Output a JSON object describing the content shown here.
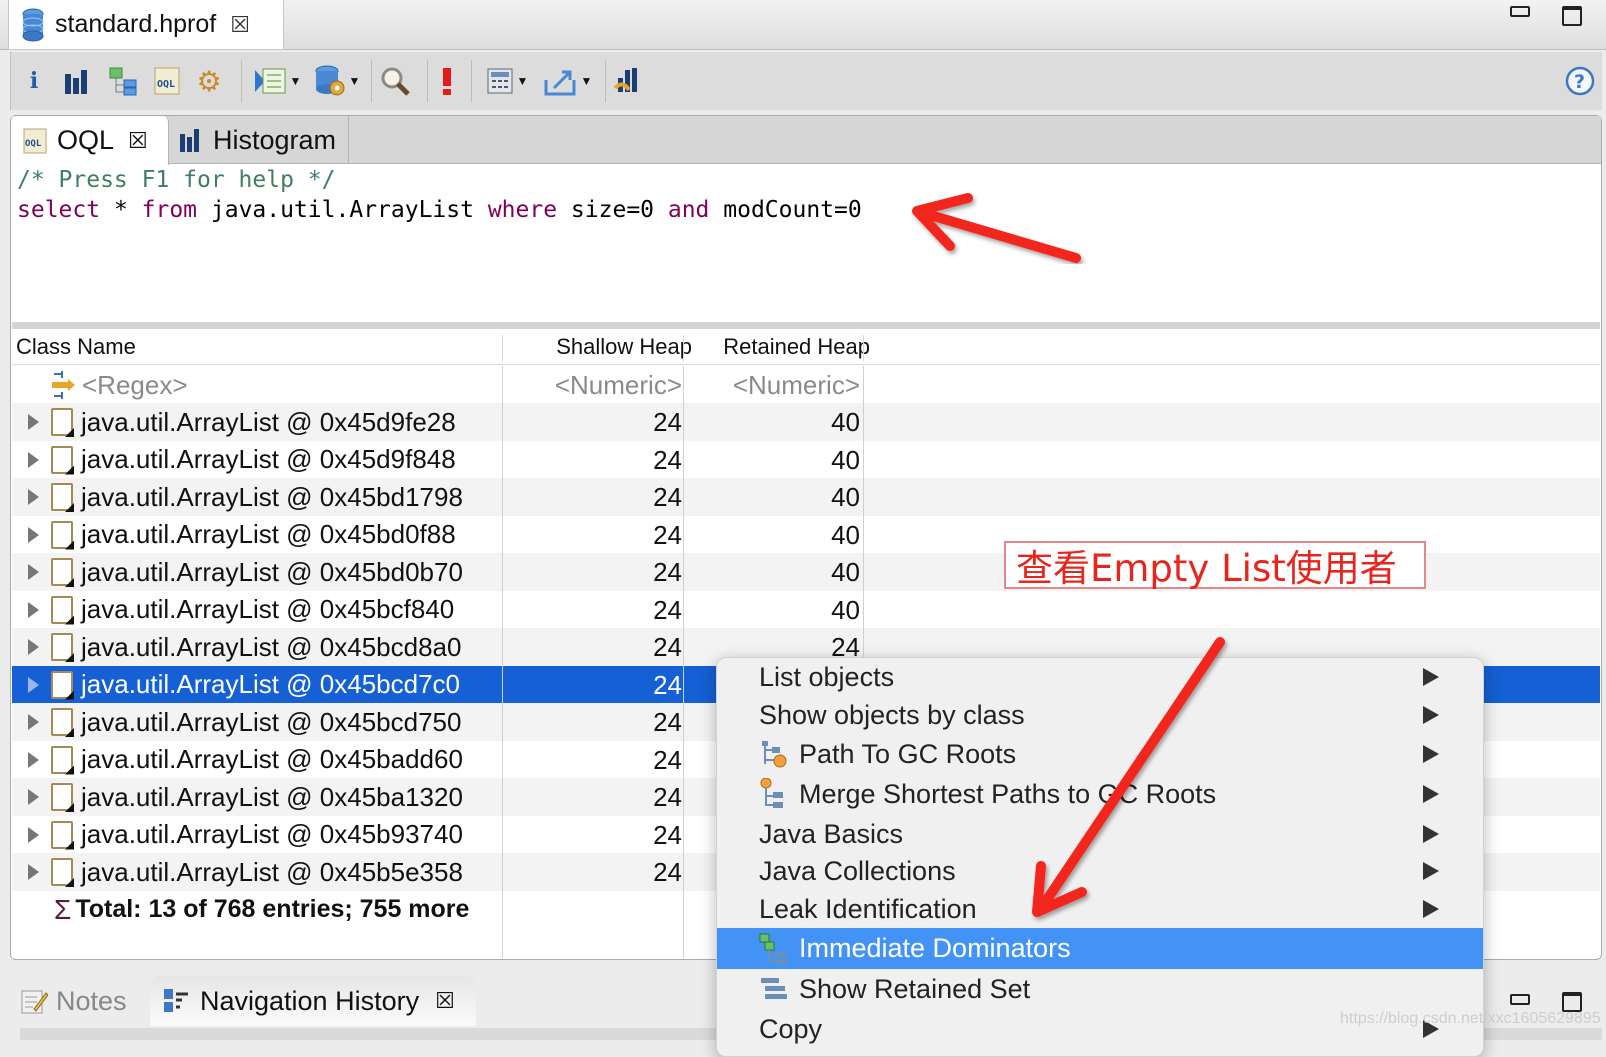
{
  "editor": {
    "tab_title": "standard.hprof",
    "tab_icon": "heap-dump-icon",
    "close_glyph": "☒"
  },
  "toolbar": {
    "items": [
      {
        "name": "overview-icon",
        "glyph": "i"
      },
      {
        "name": "histogram-icon",
        "glyph": "▮▮▮"
      },
      {
        "name": "dominator-tree-icon",
        "glyph": "⊞"
      },
      {
        "name": "oql-icon",
        "glyph": "OQL"
      },
      {
        "name": "thread-overview-icon",
        "glyph": "⚙"
      },
      {
        "name": "run-report-icon",
        "glyph": "▶"
      },
      {
        "name": "heap-dump-query-icon",
        "glyph": "⛁"
      },
      {
        "name": "search-icon",
        "glyph": "🔍"
      },
      {
        "name": "leak-suspects-icon",
        "glyph": "!"
      },
      {
        "name": "calculator-icon",
        "glyph": "▦"
      },
      {
        "name": "export-icon",
        "glyph": "⇗"
      },
      {
        "name": "compare-icon",
        "glyph": "▮"
      }
    ],
    "help_glyph": "?"
  },
  "inner_tabs": [
    {
      "label": "OQL",
      "icon": "oql-icon",
      "active": true
    },
    {
      "label": "Histogram",
      "icon": "histogram-icon",
      "active": false
    }
  ],
  "query": {
    "comment": "/* Press F1 for help */",
    "tokens": [
      {
        "t": "select",
        "k": "kw"
      },
      {
        "t": " * ",
        "k": "tx"
      },
      {
        "t": "from",
        "k": "kw"
      },
      {
        "t": " java.util.ArrayList ",
        "k": "tx"
      },
      {
        "t": "where",
        "k": "kw"
      },
      {
        "t": " size=0 ",
        "k": "tx"
      },
      {
        "t": "and",
        "k": "kw"
      },
      {
        "t": " modCount=0",
        "k": "tx"
      }
    ]
  },
  "table": {
    "columns": [
      "Class Name",
      "Shallow Heap",
      "Retained Heap"
    ],
    "filter": {
      "name": "<Regex>",
      "shallow": "<Numeric>",
      "retained": "<Numeric>"
    },
    "rows": [
      {
        "name": "java.util.ArrayList @ 0x45d9fe28",
        "shallow": "24",
        "retained": "40"
      },
      {
        "name": "java.util.ArrayList @ 0x45d9f848",
        "shallow": "24",
        "retained": "40"
      },
      {
        "name": "java.util.ArrayList @ 0x45bd1798",
        "shallow": "24",
        "retained": "40"
      },
      {
        "name": "java.util.ArrayList @ 0x45bd0f88",
        "shallow": "24",
        "retained": "40"
      },
      {
        "name": "java.util.ArrayList @ 0x45bd0b70",
        "shallow": "24",
        "retained": "40"
      },
      {
        "name": "java.util.ArrayList @ 0x45bcf840",
        "shallow": "24",
        "retained": "40"
      },
      {
        "name": "java.util.ArrayList @ 0x45bcd8a0",
        "shallow": "24",
        "retained": "24"
      },
      {
        "name": "java.util.ArrayList @ 0x45bcd7c0",
        "shallow": "24",
        "retained": "",
        "selected": true
      },
      {
        "name": "java.util.ArrayList @ 0x45bcd750",
        "shallow": "24",
        "retained": ""
      },
      {
        "name": "java.util.ArrayList @ 0x45badd60",
        "shallow": "24",
        "retained": ""
      },
      {
        "name": "java.util.ArrayList @ 0x45ba1320",
        "shallow": "24",
        "retained": ""
      },
      {
        "name": "java.util.ArrayList @ 0x45b93740",
        "shallow": "24",
        "retained": ""
      },
      {
        "name": "java.util.ArrayList @ 0x45b5e358",
        "shallow": "24",
        "retained": ""
      }
    ],
    "total": "Total: 13 of 768 entries; 755 more"
  },
  "annotation": {
    "label": "查看Empty List使用者",
    "color": "#e8251c"
  },
  "context_menu": {
    "items": [
      {
        "label": "List objects",
        "icon": "",
        "submenu": true
      },
      {
        "label": "Show objects by class",
        "icon": "",
        "submenu": true
      },
      {
        "label": "Path To GC Roots",
        "icon": "path-to-gc-roots-icon",
        "submenu": true
      },
      {
        "label": "Merge Shortest Paths to GC Roots",
        "icon": "merge-paths-icon",
        "submenu": true
      },
      {
        "label": "Java Basics",
        "icon": "",
        "submenu": true
      },
      {
        "label": "Java Collections",
        "icon": "",
        "submenu": true
      },
      {
        "label": "Leak Identification",
        "icon": "",
        "submenu": true
      },
      {
        "label": "Immediate Dominators",
        "icon": "immediate-dominators-icon",
        "submenu": false,
        "highlighted": true
      },
      {
        "label": "Show Retained Set",
        "icon": "retained-set-icon",
        "submenu": false
      },
      {
        "label": "Copy",
        "icon": "",
        "submenu": true
      }
    ]
  },
  "bottom_tabs": [
    {
      "label": "Notes",
      "icon": "notes-icon",
      "active": false
    },
    {
      "label": "Navigation History",
      "icon": "navigation-history-icon",
      "active": true
    }
  ],
  "watermark": "https://blog.csdn.net/xxc1605629895",
  "colors": {
    "selection": "#1560d4",
    "menu_highlight": "#4293f5",
    "annotation_red": "#f2281e"
  }
}
